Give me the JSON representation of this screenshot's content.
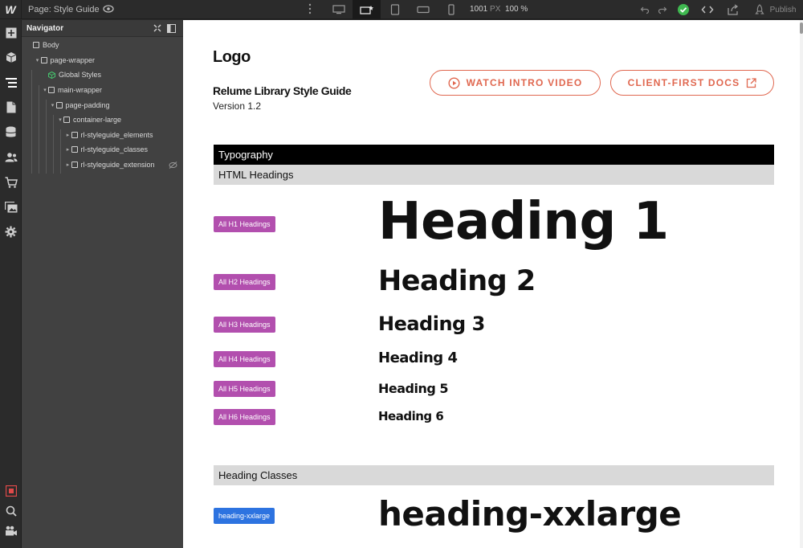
{
  "app": {
    "logo": "W",
    "page_label": "Page: Style Guide",
    "width_value": "1001",
    "width_unit": "PX",
    "zoom": "100 %",
    "publish_label": "Publish",
    "accent_color": "#e0674f",
    "tag_color": "#b24fae",
    "class_tag_color": "#2d73e0"
  },
  "navigator": {
    "title": "Navigator",
    "items": [
      {
        "label": "Body",
        "indent": 0,
        "caret": false,
        "icon": "box"
      },
      {
        "label": "page-wrapper",
        "indent": 1,
        "caret": true,
        "icon": "box"
      },
      {
        "label": "Global Styles",
        "indent": 2,
        "caret": false,
        "icon": "component"
      },
      {
        "label": "main-wrapper",
        "indent": 2,
        "caret": true,
        "icon": "box"
      },
      {
        "label": "page-padding",
        "indent": 3,
        "caret": true,
        "icon": "box"
      },
      {
        "label": "container-large",
        "indent": 4,
        "caret": true,
        "icon": "box"
      },
      {
        "label": "rl-styleguide_elements",
        "indent": 5,
        "caret": true,
        "icon": "box"
      },
      {
        "label": "rl-styleguide_classes",
        "indent": 5,
        "caret": true,
        "icon": "box"
      },
      {
        "label": "rl-styleguide_extension",
        "indent": 5,
        "caret": true,
        "icon": "box",
        "hidden": true
      }
    ]
  },
  "canvas": {
    "logo": "Logo",
    "title": "Relume Library Style Guide",
    "version": "Version 1.2",
    "watch_button": "WATCH INTRO VIDEO",
    "docs_button": "CLIENT-FIRST DOCS",
    "section_typography": "Typography",
    "subsection_html": "HTML Headings",
    "subsection_classes": "Heading Classes",
    "headings": [
      {
        "tag": "All H1 Headings",
        "text": "Heading 1"
      },
      {
        "tag": "All H2 Headings",
        "text": "Heading 2"
      },
      {
        "tag": "All H3 Headings",
        "text": "Heading 3"
      },
      {
        "tag": "All H4 Headings",
        "text": "Heading 4"
      },
      {
        "tag": "All H5 Headings",
        "text": "Heading 5"
      },
      {
        "tag": "All H6 Headings",
        "text": "Heading 6"
      }
    ],
    "class_headings": [
      {
        "tag": "heading-xxlarge",
        "text": "heading-xxlarge"
      }
    ]
  }
}
